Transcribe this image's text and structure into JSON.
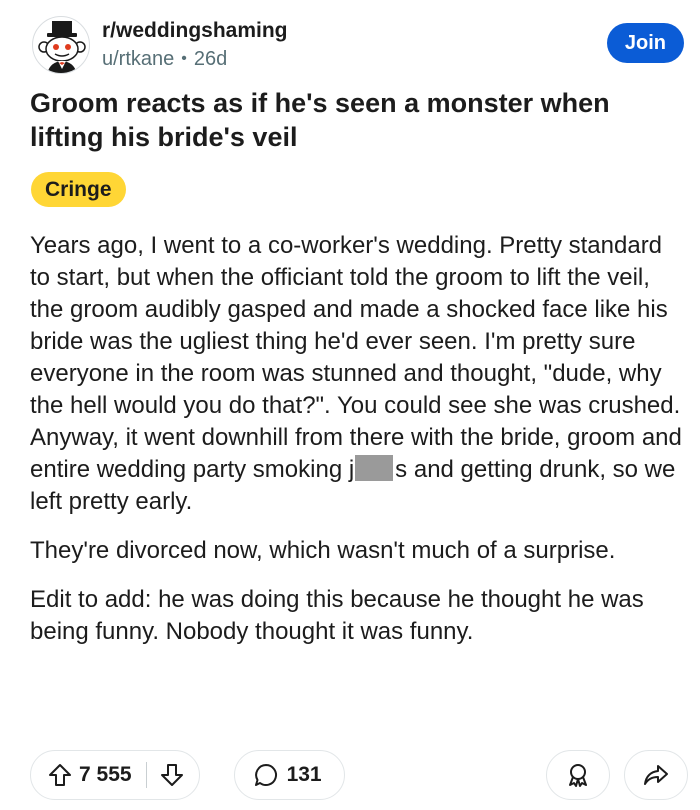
{
  "header": {
    "subreddit": "r/weddingshaming",
    "username": "u/rtkane",
    "separator": "•",
    "age": "26d",
    "join_label": "Join",
    "avatar_icon": "reddit-snoo-groom-icon"
  },
  "post": {
    "title": "Groom reacts as if he's seen a monster when lifting his bride's veil",
    "flair": "Cringe",
    "flair_color": "#ffd635",
    "paragraph1_before": "Years ago, I went to a co-worker's wedding.  Pretty standard to start, but when the officiant told the groom to lift the veil, the groom audibly gasped and made a shocked face like his bride was the ugliest thing he'd ever seen.  I'm pretty sure everyone in the room was stunned and thought, \"dude, why the hell would you do that?\".  You could see she was crushed.  Anyway, it went downhill from there with the bride, groom and entire wedding party smoking j",
    "paragraph1_after": "s and getting drunk, so we left pretty early.",
    "paragraph2": "They're divorced now, which wasn't much of a surprise.",
    "paragraph3": "Edit to add: he was doing this because he thought he was being funny.  Nobody thought it was funny."
  },
  "actions": {
    "upvotes": "7 555",
    "comments": "131",
    "icons": [
      "upvote-icon",
      "downvote-icon",
      "comment-icon",
      "award-icon",
      "share-icon"
    ]
  },
  "colors": {
    "accent": "#0b5cd6",
    "text": "#1c1c1c",
    "muted": "#576f76"
  }
}
